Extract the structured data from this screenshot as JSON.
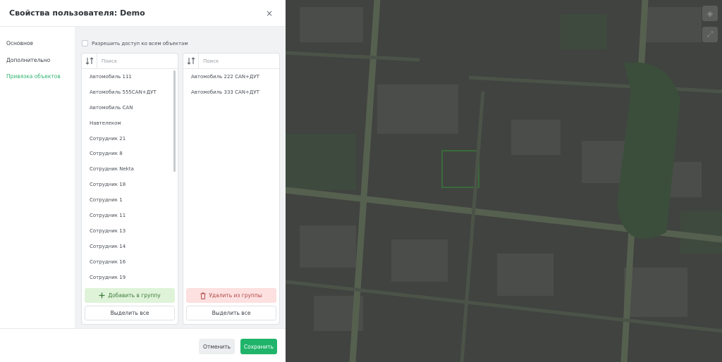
{
  "modal": {
    "title": "Свойства пользователя: Demo",
    "close_glyph": "×"
  },
  "nav": {
    "items": [
      {
        "label": "Основное",
        "active": false
      },
      {
        "label": "Дополнительно",
        "active": false
      },
      {
        "label": "Привязка объектов",
        "active": true
      }
    ]
  },
  "allow_all": {
    "label": "Разрешить доступ ко всем объектам",
    "checked": false
  },
  "left_panel": {
    "search_placeholder": "Поиск",
    "items": [
      "Автомобиль 111",
      "Автомобиль 555CAN+ДУТ",
      "Автомобиль CAN",
      "Навтелеком",
      "Сотрудник 21",
      "Сотрудник 8",
      "Сотрудник Nekta",
      "Сотрудник 18",
      "Сотрудник 1",
      "Сотрудник 11",
      "Сотрудник 13",
      "Сотрудник 14",
      "Сотрудник 16",
      "Сотрудник 19"
    ],
    "action_label": "Добавить в группу",
    "select_all_label": "Выделить все"
  },
  "right_panel": {
    "search_placeholder": "Поиск",
    "items": [
      "Автомобиль 222 CAN+ДУТ",
      "Автомобиль 333 CAN+ДУТ"
    ],
    "action_label": "Удалить из группы",
    "select_all_label": "Выделить все"
  },
  "footer": {
    "cancel_label": "Отменить",
    "save_label": "Сохранить"
  },
  "colors": {
    "accent": "#1fb46a",
    "nav_active": "#2fb36f",
    "add_bg": "#dff3d9",
    "remove_bg": "#fde0e0"
  },
  "icons": {
    "sort": "sort-icon",
    "add": "plus-icon",
    "remove": "trash-icon",
    "close": "close-icon"
  }
}
